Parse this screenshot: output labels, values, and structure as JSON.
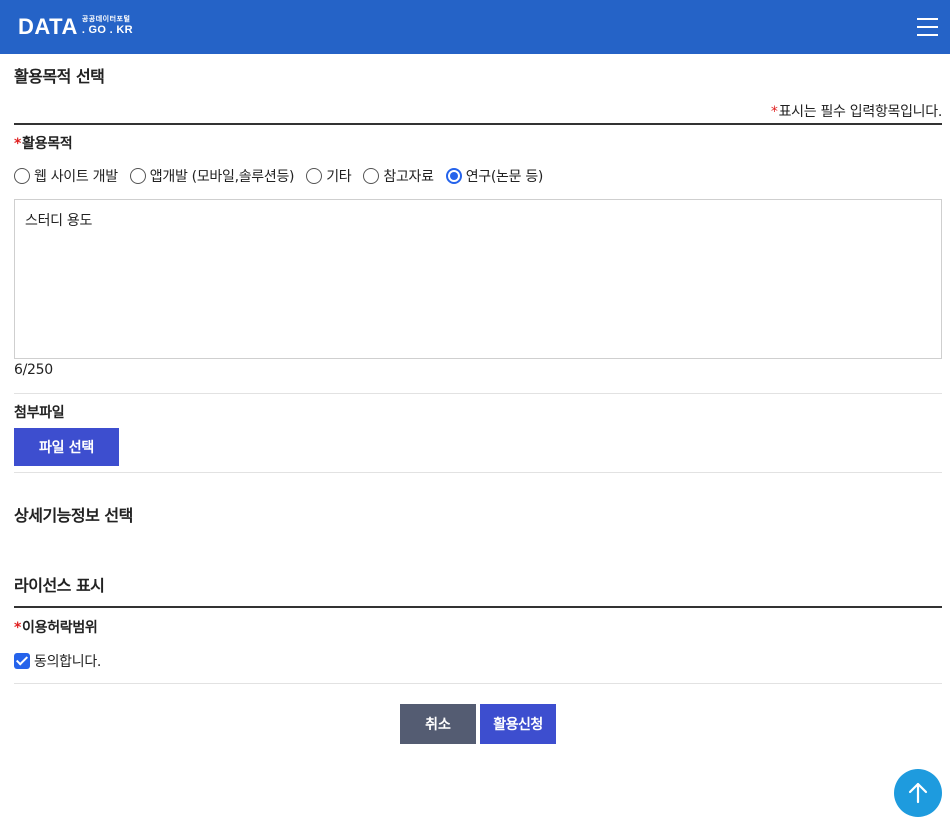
{
  "header": {
    "logo_main": "DATA",
    "logo_sub_top": "공공데이터포털",
    "logo_sub_bottom": ". GO . KR",
    "menu_icon": "hamburger-menu-icon"
  },
  "purpose_section": {
    "title": "활용목적 선택",
    "required_star": "*",
    "required_notice": "표시는 필수 입력항목입니다.",
    "purpose_label": "활용목적",
    "options": [
      {
        "label": "웹 사이트 개발",
        "checked": false
      },
      {
        "label": "앱개발 (모바일,솔루션등)",
        "checked": false
      },
      {
        "label": "기타",
        "checked": false
      },
      {
        "label": "참고자료",
        "checked": false
      },
      {
        "label": "연구(논문 등)",
        "checked": true
      }
    ],
    "textarea_value": "스터디 용도",
    "char_count": "6/250"
  },
  "attachment": {
    "label": "첨부파일",
    "button": "파일 선택"
  },
  "detail_section": {
    "title": "상세기능정보 선택"
  },
  "license_section": {
    "title": "라이선스 표시",
    "scope_label": "이용허락범위",
    "agree_label": "동의합니다.",
    "agree_checked": true
  },
  "actions": {
    "cancel": "취소",
    "submit": "활용신청"
  },
  "scroll_top_icon": "arrow-up-icon",
  "colors": {
    "header": "#2563c7",
    "primary_button": "#3d4ecf",
    "cancel_button": "#545c72",
    "required": "#e02020",
    "scroll_top": "#1e9bde"
  }
}
